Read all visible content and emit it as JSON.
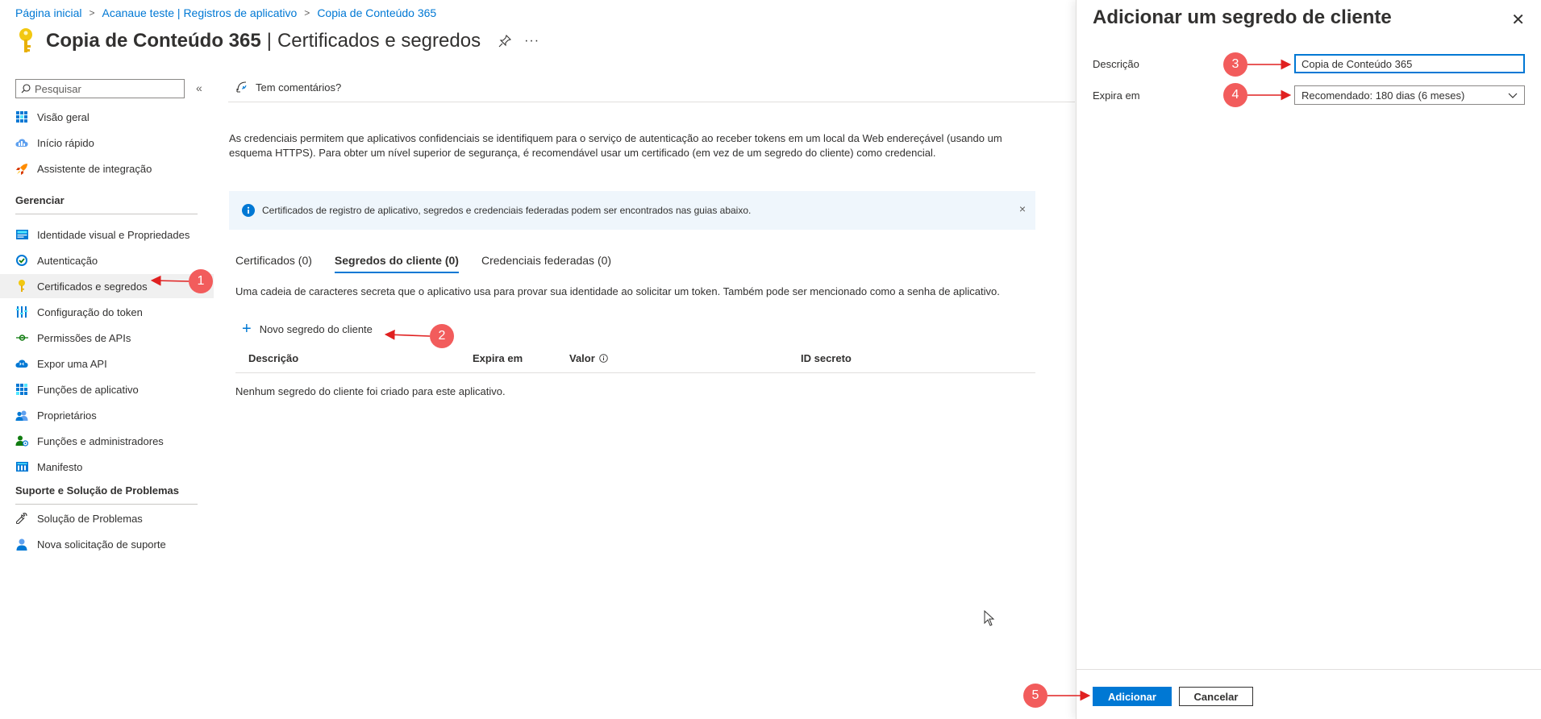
{
  "breadcrumb": {
    "home": "Página inicial",
    "registrations": "Acanaue teste | Registros de aplicativo",
    "app": "Copia de Conteúdo 365"
  },
  "title": {
    "app_name": "Copia de Conteúdo 365",
    "separator": "|",
    "page_name": "Certificados e segredos",
    "more": "···"
  },
  "sidebar": {
    "search_placeholder": "Pesquisar",
    "collapse": "«",
    "items": [
      {
        "label": "Visão geral"
      },
      {
        "label": "Início rápido"
      },
      {
        "label": "Assistente de integração"
      }
    ],
    "section_manage": "Gerenciar",
    "manage_items": [
      {
        "label": "Identidade visual e Propriedades"
      },
      {
        "label": "Autenticação"
      },
      {
        "label": "Certificados e segredos"
      },
      {
        "label": "Configuração do token"
      },
      {
        "label": "Permissões de APIs"
      },
      {
        "label": "Expor uma API"
      },
      {
        "label": "Funções de aplicativo"
      },
      {
        "label": "Proprietários"
      },
      {
        "label": "Funções e administradores"
      },
      {
        "label": "Manifesto"
      }
    ],
    "section_support": "Suporte e Solução de Problemas",
    "support_items": [
      {
        "label": "Solução de Problemas"
      },
      {
        "label": "Nova solicitação de suporte"
      }
    ]
  },
  "main": {
    "feedback": "Tem comentários?",
    "description": "As credenciais permitem que aplicativos confidenciais se identifiquem para o serviço de autenticação ao receber tokens em um local da Web endereçável (usando um esquema HTTPS). Para obter um nível superior de segurança, é recomendável usar um certificado (em vez de um segredo do cliente) como credencial.",
    "info_bar": "Certificados de registro de aplicativo, segredos e credenciais federadas podem ser encontrados nas guias abaixo.",
    "info_close": "×",
    "tabs": [
      {
        "label": "Certificados (0)"
      },
      {
        "label": "Segredos do cliente (0)"
      },
      {
        "label": "Credenciais federadas (0)"
      }
    ],
    "tab_description": "Uma cadeia de caracteres secreta que o aplicativo usa para provar sua identidade ao solicitar um token. Também pode ser mencionado como a senha de aplicativo.",
    "new_secret": "Novo segredo do cliente",
    "table": {
      "columns": [
        "Descrição",
        "Expira em",
        "Valor",
        "ID secreto"
      ],
      "empty": "Nenhum segredo do cliente foi criado para este aplicativo."
    }
  },
  "panel": {
    "title": "Adicionar um segredo de cliente",
    "close": "✕",
    "description_label": "Descrição",
    "description_value": "Copia de Conteúdo 365",
    "expires_label": "Expira em",
    "expires_value": "Recomendado: 180 dias (6 meses)",
    "add_button": "Adicionar",
    "cancel_button": "Cancelar"
  },
  "annotations": {
    "step1": "1",
    "step2": "2",
    "step3": "3",
    "step4": "4",
    "step5": "5",
    "color": "#f25c5c",
    "arrow_color": "#e02020"
  },
  "colors": {
    "accent": "#0078d4",
    "info_bg": "#eff6fc",
    "active_nav": "#f0f0f0"
  }
}
